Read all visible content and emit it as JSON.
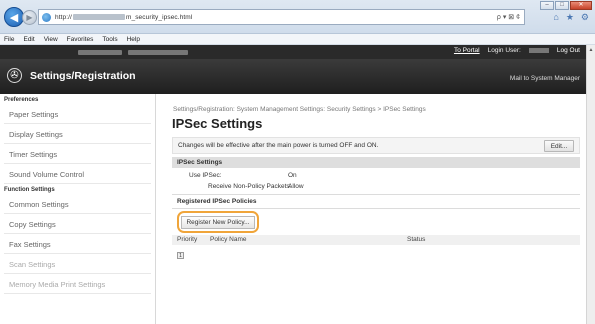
{
  "browser": {
    "url_prefix": "http://",
    "url_mid": "m_security_ipsec.html",
    "search_symbol": "ρ ▾ ⊠ ¢",
    "menu": [
      "File",
      "Edit",
      "View",
      "Favorites",
      "Tools",
      "Help"
    ]
  },
  "app": {
    "title": "Settings/Registration",
    "top_links": {
      "to_portal": "To Portal",
      "login_user_label": "Login User:",
      "logout": "Log Out",
      "mail": "Mail to System Manager"
    }
  },
  "sidebar": {
    "groups": [
      {
        "label": "Preferences",
        "items": [
          "Paper Settings",
          "Display Settings",
          "Timer Settings",
          "Sound Volume Control"
        ]
      },
      {
        "label": "Function Settings",
        "items": [
          "Common Settings",
          "Copy Settings",
          "Fax Settings",
          "Scan Settings",
          "Memory Media Print Settings"
        ]
      }
    ]
  },
  "main": {
    "breadcrumb": "Settings/Registration: System Management Settings: Security Settings > IPSec Settings",
    "title": "IPSec Settings",
    "notice": "Changes will be effective after the main power is turned OFF and ON.",
    "edit_label": "Edit...",
    "ipsec_section": "IPSec Settings",
    "use_ipsec_label": "Use IPSec:",
    "use_ipsec_value": "On",
    "receive_label": "Receive Non-Policy Packets:",
    "receive_value": "Allow",
    "policies_section": "Registered IPSec Policies",
    "register_button": "Register New Policy...",
    "columns": [
      "Priority",
      "Policy Name",
      "Status"
    ],
    "pager_label": "1"
  }
}
